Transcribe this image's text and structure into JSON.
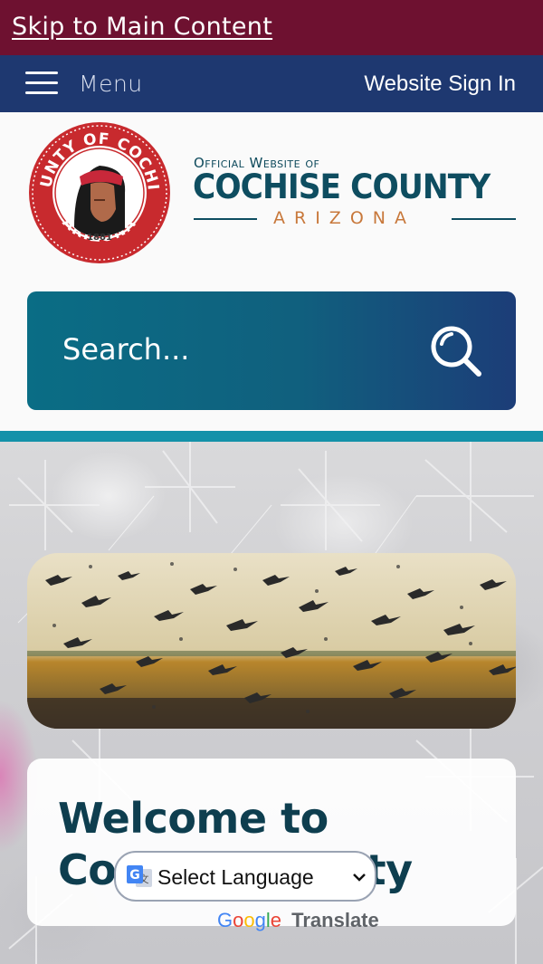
{
  "skip_link": "Skip to Main Content",
  "nav": {
    "menu_label": "Menu",
    "signin_label": "Website Sign In"
  },
  "brand": {
    "official": "Official Website of",
    "name": "COCHISE COUNTY",
    "state": "ARIZONA",
    "seal_top": "COUNTY OF COCHISE",
    "seal_bottom": "ARIZONA",
    "seal_year": "1881"
  },
  "search": {
    "placeholder": "Search..."
  },
  "welcome": {
    "title": "Welcome to Cochise County"
  },
  "translate": {
    "select_label": "Select Language",
    "powered_by": [
      "G",
      "o",
      "o",
      "g",
      "l",
      "e"
    ],
    "translate_label": "Translate"
  },
  "colors": {
    "maroon": "#6e1130",
    "navy": "#1e3870",
    "teal": "#1391a9",
    "dark_teal": "#0e4d60",
    "orange": "#c8783b"
  }
}
